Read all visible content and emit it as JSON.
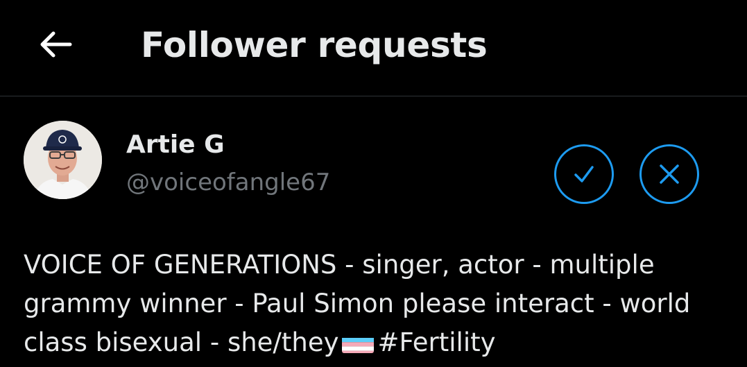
{
  "header": {
    "title": "Follower requests",
    "back_icon": "arrow-left-icon"
  },
  "request": {
    "name": "Artie G",
    "handle": "@voiceofangle67",
    "accept_icon": "checkmark-icon",
    "decline_icon": "close-icon",
    "bio_main": "VOICE OF GENERATIONS - singer, actor - multiple grammy winner - Paul Simon please interact - world class bisexual - she/they",
    "bio_flag_icon": "transgender-flag-icon",
    "bio_hashtag": "#Fertility"
  },
  "colors": {
    "background": "#000000",
    "text_primary": "#e7e9ea",
    "text_secondary": "#71767b",
    "accent": "#1d9bf0",
    "divider": "#2f3336"
  }
}
